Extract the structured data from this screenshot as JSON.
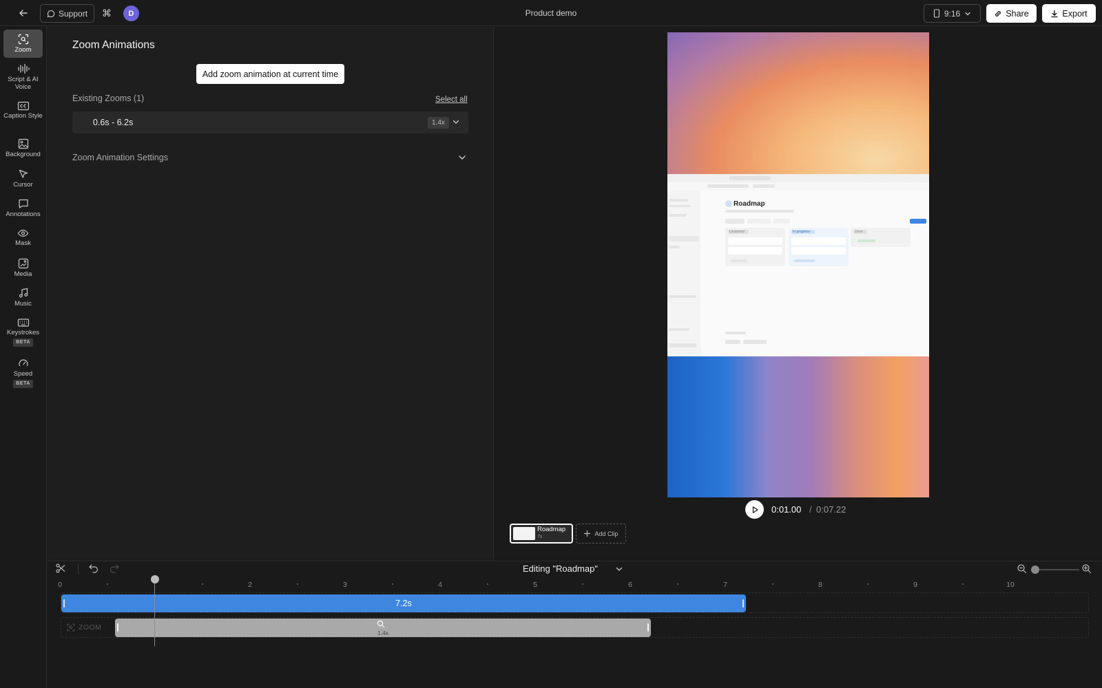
{
  "topbar": {
    "support_label": "Support",
    "cmd_glyph": "⌘",
    "avatar_initial": "D",
    "project_title": "Product demo",
    "ratio_label": "9:16",
    "share_label": "Share",
    "export_label": "Export"
  },
  "rail": {
    "items": [
      {
        "label": "Zoom",
        "icon": "zoom-icon",
        "active": true
      },
      {
        "label": "Script & AI Voice",
        "icon": "waveform-icon"
      },
      {
        "label": "Caption Style",
        "icon": "caption-icon"
      },
      {
        "label": "Background",
        "icon": "image-icon"
      },
      {
        "label": "Cursor",
        "icon": "cursor-icon"
      },
      {
        "label": "Annotations",
        "icon": "annotation-icon"
      },
      {
        "label": "Mask",
        "icon": "eye-icon"
      },
      {
        "label": "Media",
        "icon": "media-icon"
      },
      {
        "label": "Music",
        "icon": "music-icon"
      },
      {
        "label": "Keystrokes",
        "icon": "keyboard-icon",
        "badge": "BETA"
      },
      {
        "label": "Speed",
        "icon": "speedometer-icon",
        "badge": "BETA"
      }
    ]
  },
  "panel": {
    "title": "Zoom Animations",
    "add_button": "Add zoom animation at current time",
    "existing_label": "Existing Zooms (1)",
    "select_all": "Select all",
    "zooms": [
      {
        "range": "0.6s - 6.2s",
        "scale": "1.4x"
      }
    ],
    "settings_label": "Zoom Animation Settings"
  },
  "preview": {
    "app_title": "Roadmap",
    "columns": [
      "Unstarted",
      "In progress",
      "Done"
    ]
  },
  "playback": {
    "current_time": "0:01.00",
    "separator": "/",
    "total_time": "0:07.22"
  },
  "clips": {
    "items": [
      {
        "name": "Roadmap",
        "duration": "7s"
      }
    ],
    "add_label": "Add Clip"
  },
  "timeline": {
    "editing_label": "Editing \"Roadmap\"",
    "ticks": [
      "0",
      "2",
      "3",
      "4",
      "5",
      "6",
      "7",
      "8",
      "9",
      "10"
    ],
    "clip_bar_label": "7.2s",
    "zoom_track_label": "ZOOM",
    "zoom_bar_value": "1.4x",
    "playhead_time_s": 1.0
  },
  "colors": {
    "accent_clip": "#3f86e0",
    "zoom_bar": "#a9a9a9",
    "avatar": "#6c63d9"
  }
}
